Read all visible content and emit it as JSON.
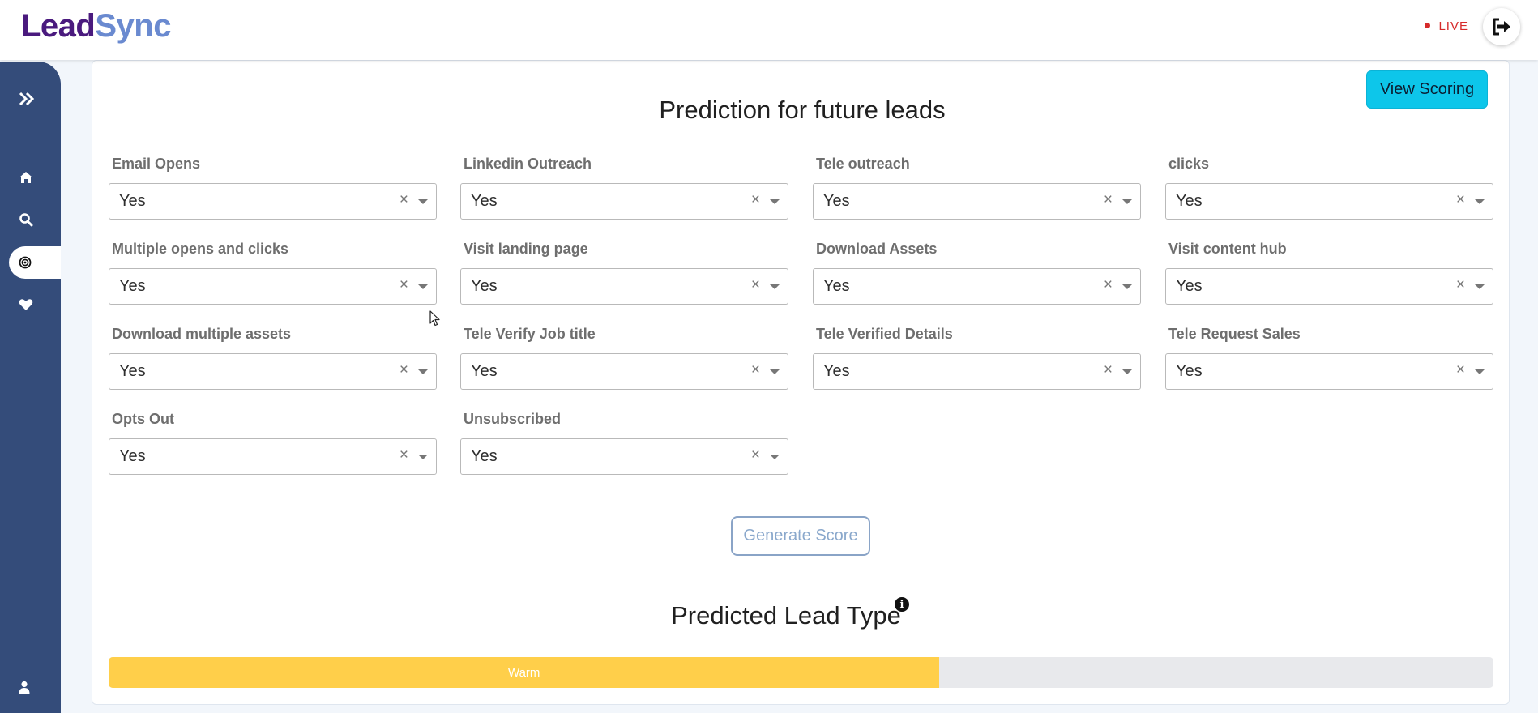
{
  "header": {
    "logo_part1": "Lead",
    "logo_part2": "Sync",
    "live_label": "LIVE",
    "logout_icon": "sign-out-icon"
  },
  "sidebar": {
    "items": [
      {
        "name": "expand",
        "icon": "chevrons-right-icon"
      },
      {
        "name": "home",
        "icon": "home-icon"
      },
      {
        "name": "search",
        "icon": "search-icon"
      },
      {
        "name": "prediction",
        "icon": "target-icon",
        "active": true
      },
      {
        "name": "favorites",
        "icon": "heart-icon"
      },
      {
        "name": "profile",
        "icon": "user-icon"
      }
    ]
  },
  "main": {
    "view_scoring_label": "View Scoring",
    "title": "Prediction for future leads",
    "fields": [
      {
        "label": "Email Opens",
        "value": "Yes"
      },
      {
        "label": "Linkedin Outreach",
        "value": "Yes"
      },
      {
        "label": "Tele outreach",
        "value": "Yes"
      },
      {
        "label": "clicks",
        "value": "Yes"
      },
      {
        "label": "Multiple opens and clicks",
        "value": "Yes"
      },
      {
        "label": "Visit landing page",
        "value": "Yes"
      },
      {
        "label": "Download Assets",
        "value": "Yes"
      },
      {
        "label": "Visit content hub",
        "value": "Yes"
      },
      {
        "label": "Download multiple assets",
        "value": "Yes"
      },
      {
        "label": "Tele Verify Job title",
        "value": "Yes"
      },
      {
        "label": "Tele Verified Details",
        "value": "Yes"
      },
      {
        "label": "Tele Request Sales",
        "value": "Yes"
      },
      {
        "label": "Opts Out",
        "value": "Yes"
      },
      {
        "label": "Unsubscribed",
        "value": "Yes"
      }
    ],
    "clear_glyph": "×",
    "generate_label": "Generate Score",
    "predicted_title": "Predicted Lead Type",
    "info_glyph": "i",
    "result": {
      "label": "Warm",
      "progress_percent": 60,
      "fill_color": "#ffcf4a"
    }
  },
  "colors": {
    "sidebar_bg": "#344c7a",
    "accent_button": "#0dc6ea",
    "live_red": "#d62b2b"
  }
}
